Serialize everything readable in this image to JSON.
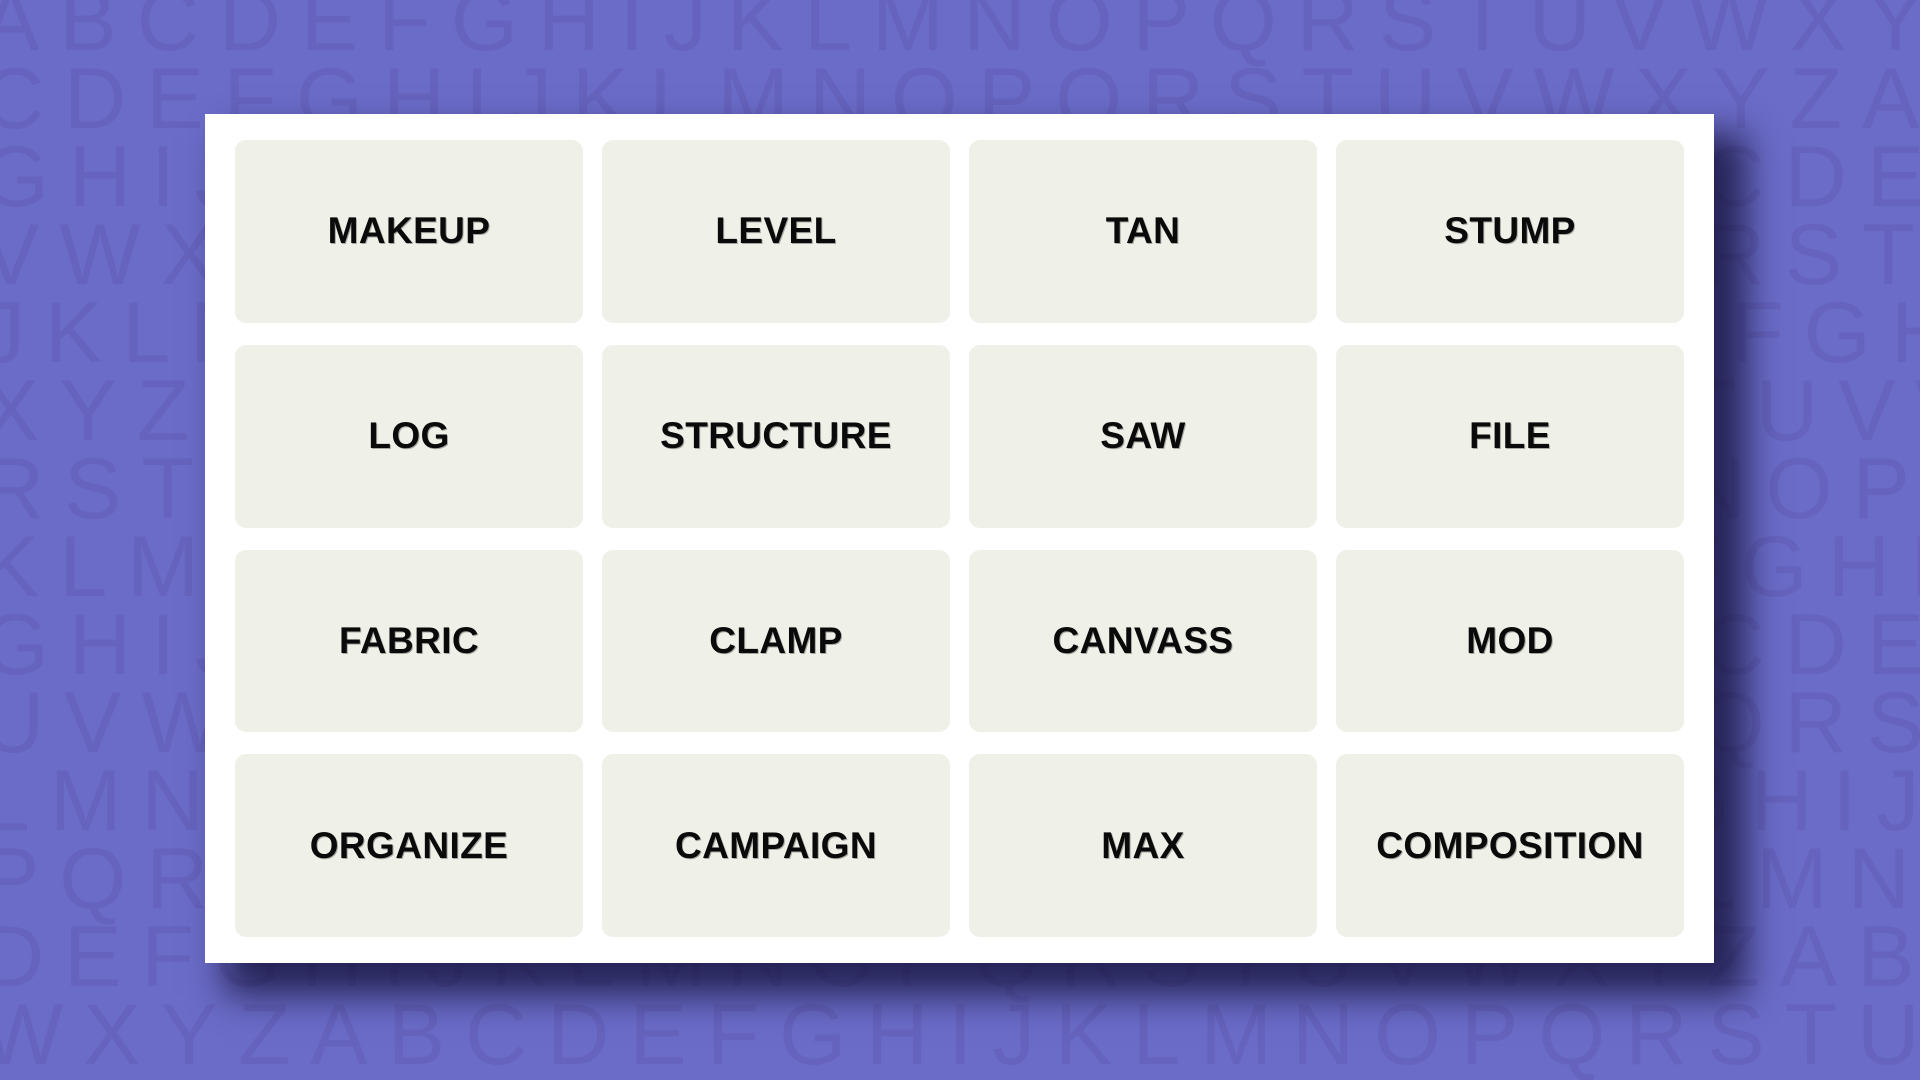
{
  "app": {
    "name": "word-grouping-puzzle",
    "background_color": "#6b6cc8",
    "background_letter_color": "#6563bd",
    "card_color": "#ffffff",
    "tile_color": "#eff0e8",
    "tile_text_color": "#0a0a0a",
    "shadow_color": "#14123a"
  },
  "background": {
    "alphabet": "ABCDEFGHIJKLMNOPQRSTUVWXYZ",
    "rows": [
      "ABCDEFGHIJKLMNOPQRSTUVWXYZABCDEF",
      "CDEFGHIJKLMNOPQRSTUVWXYZABCDEFGH",
      "GHIJKLMNOPQRSTUVWXYZABCDEFGHIJKL",
      "VWXYZABCDEFGHIJKLMNOPQRSTUVWXYZA",
      "JKLMNOPQRSTUVWXYZABCDEFGHIJKLMNO",
      "XYZABCDEFGHIJKLMNOPQRSTUVWXYZABC",
      "RSTUVWXYZABCDEFGHIJKLMNOPQRSTUVW",
      "KLMNOPQRSTUVWXYZABCDEFGHIJKLMNOP",
      "GHIJKLMNOPQRSTUVWXYZABCDEFGHIJKL",
      "UVWXYZABCDEFGHIJKLMNOPQRSTUVWXYZ",
      "LMNOPQRSTUVWXYZABCDEFGHIJKLMNOPQ",
      "PQRSTUVWXYZABCDEFGHIJKLMNOPQRSTU",
      "DEFGHIJKLMNOPQRSTUVWXYZABCDEFGHI",
      "WXYZABCDEFGHIJKLMNOPQRSTUVWXYZAB"
    ]
  },
  "grid": {
    "columns": 4,
    "rows": 4,
    "tiles": [
      {
        "label": "MAKEUP",
        "row": 1,
        "col": 1
      },
      {
        "label": "LEVEL",
        "row": 1,
        "col": 2
      },
      {
        "label": "TAN",
        "row": 1,
        "col": 3
      },
      {
        "label": "STUMP",
        "row": 1,
        "col": 4
      },
      {
        "label": "LOG",
        "row": 2,
        "col": 1
      },
      {
        "label": "STRUCTURE",
        "row": 2,
        "col": 2
      },
      {
        "label": "SAW",
        "row": 2,
        "col": 3
      },
      {
        "label": "FILE",
        "row": 2,
        "col": 4
      },
      {
        "label": "FABRIC",
        "row": 3,
        "col": 1
      },
      {
        "label": "CLAMP",
        "row": 3,
        "col": 2
      },
      {
        "label": "CANVASS",
        "row": 3,
        "col": 3
      },
      {
        "label": "MOD",
        "row": 3,
        "col": 4
      },
      {
        "label": "ORGANIZE",
        "row": 4,
        "col": 1
      },
      {
        "label": "CAMPAIGN",
        "row": 4,
        "col": 2
      },
      {
        "label": "MAX",
        "row": 4,
        "col": 3
      },
      {
        "label": "COMPOSITION",
        "row": 4,
        "col": 4
      }
    ]
  }
}
